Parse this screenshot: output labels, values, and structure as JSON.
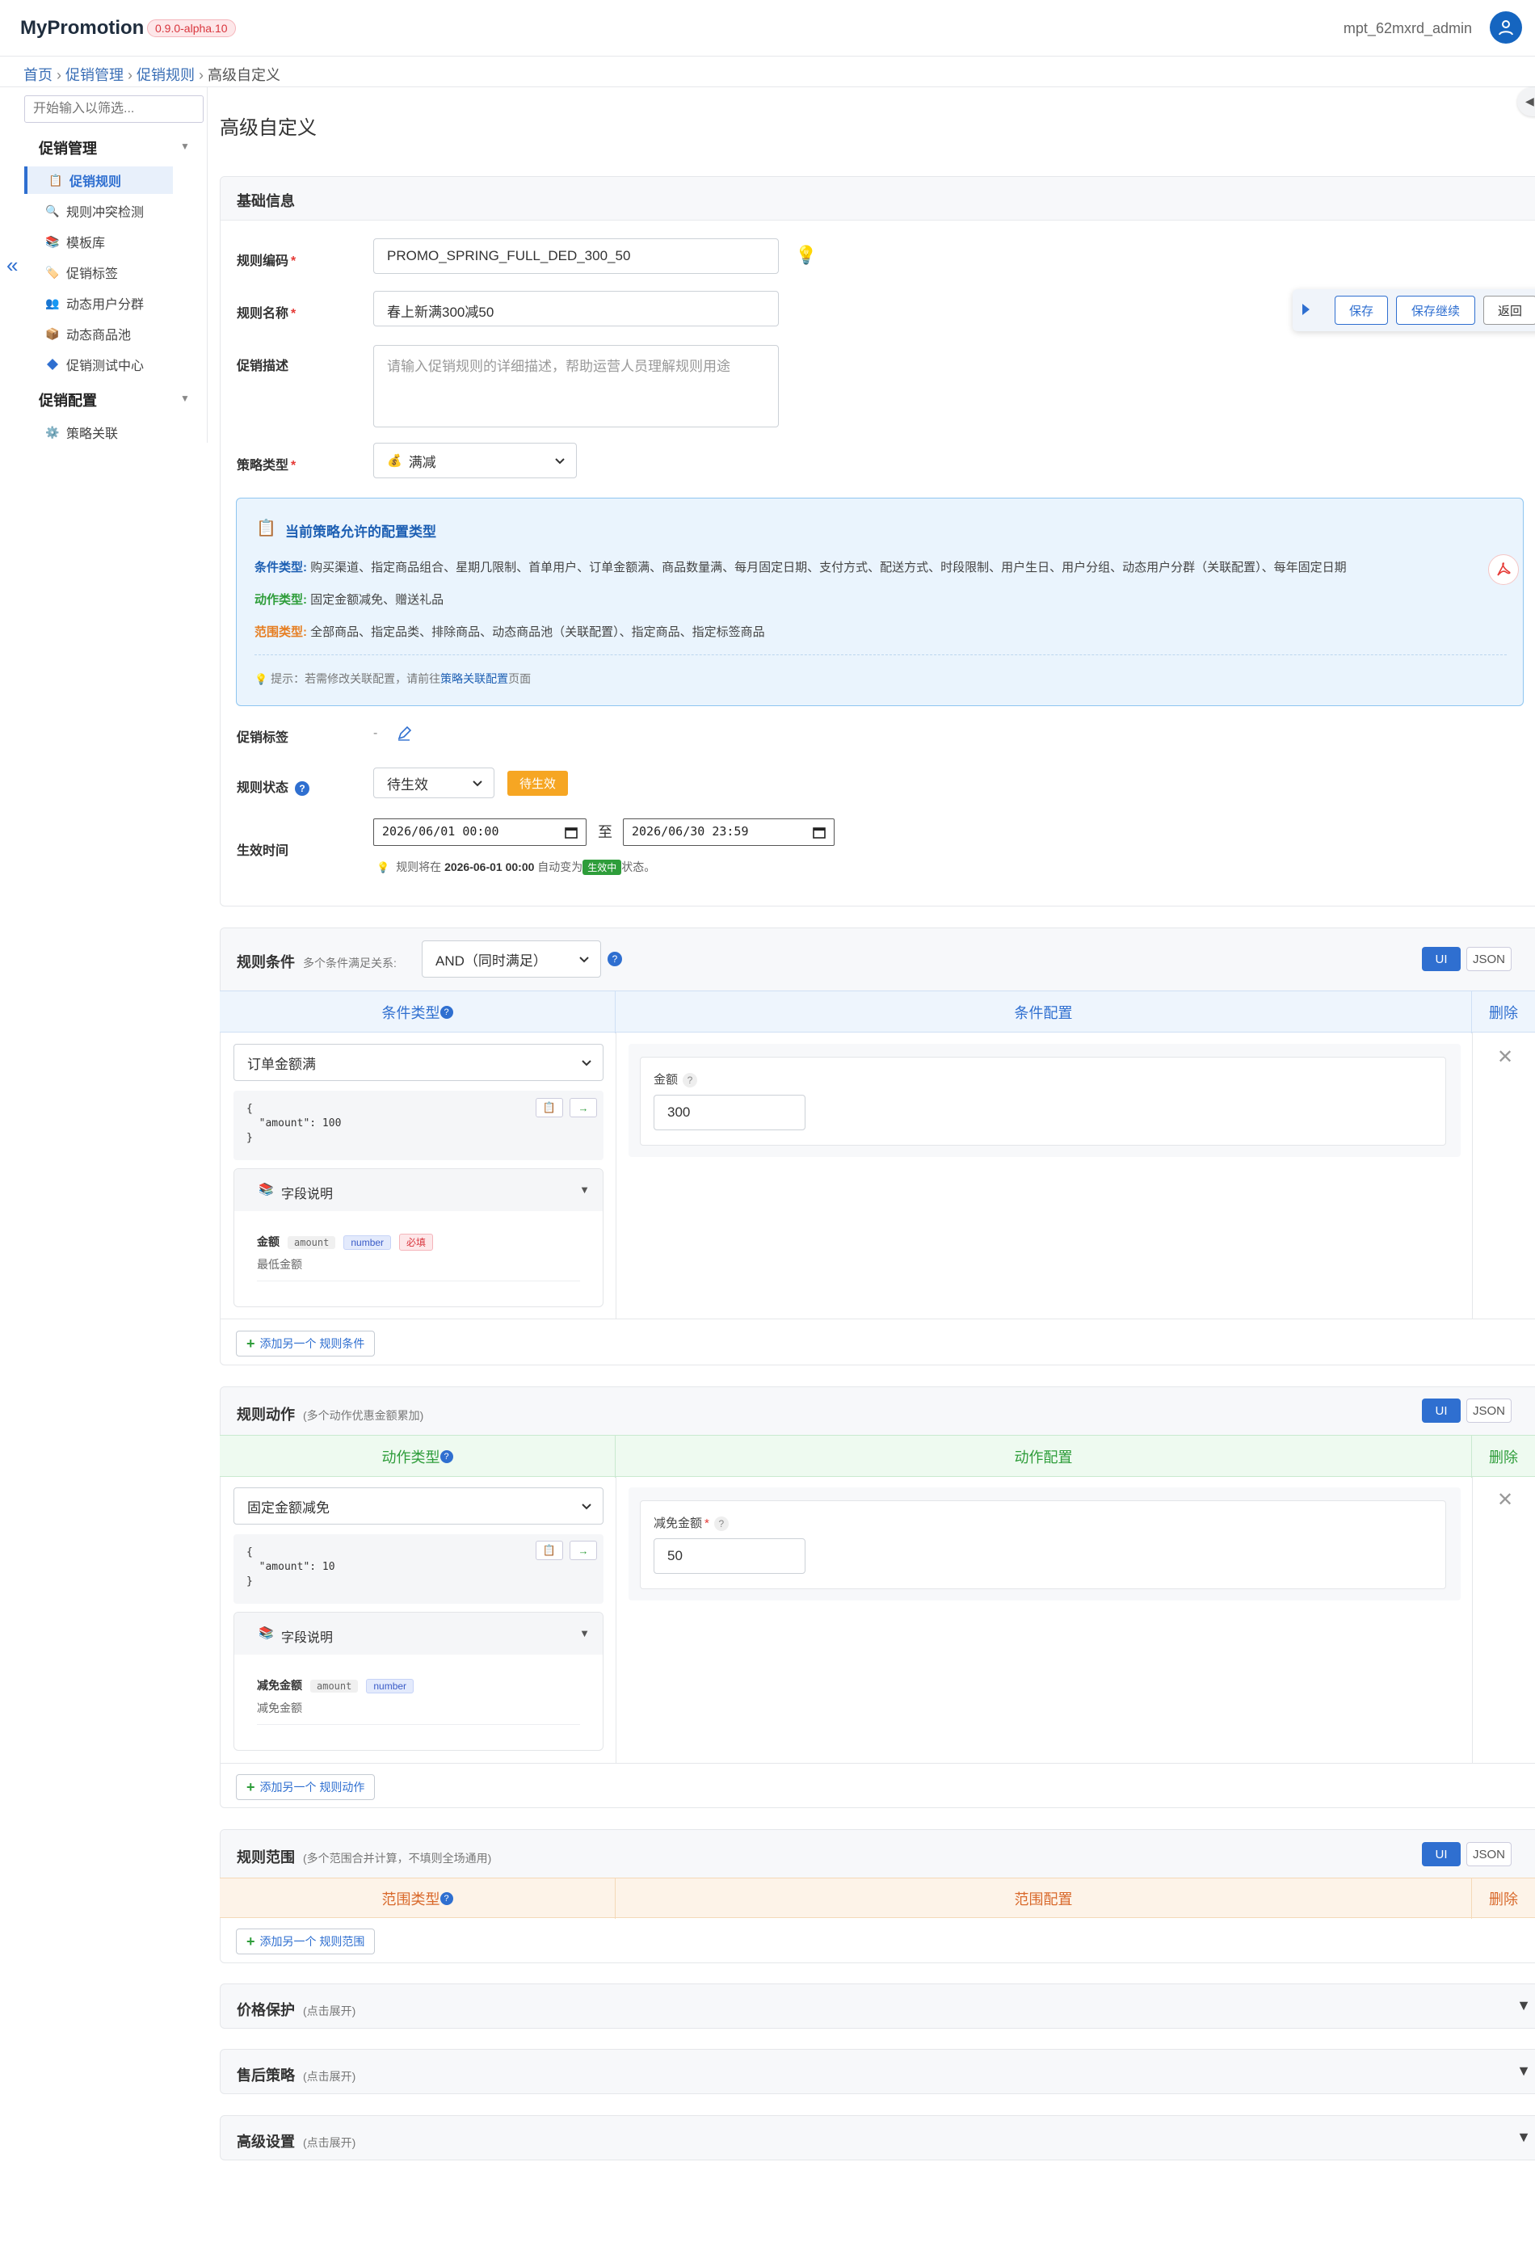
{
  "app": {
    "title": "MyPromotion",
    "version": "0.9.0-alpha.10",
    "user": "mpt_62mxrd_admin"
  },
  "breadcrumb": {
    "items": [
      "首页",
      "促销管理",
      "促销规则",
      "高级自定义"
    ]
  },
  "sidebar": {
    "filter_placeholder": "开始输入以筛选...",
    "groups": [
      {
        "label": "促销管理",
        "items": [
          {
            "label": "促销规则",
            "icon": "clipboard-icon",
            "active": true
          },
          {
            "label": "规则冲突检测",
            "icon": "magnifier-icon"
          },
          {
            "label": "模板库",
            "icon": "books-icon"
          },
          {
            "label": "促销标签",
            "icon": "tag-icon"
          },
          {
            "label": "动态用户分群",
            "icon": "users-icon"
          },
          {
            "label": "动态商品池",
            "icon": "package-icon"
          },
          {
            "label": "促销测试中心",
            "icon": "diamond-icon"
          }
        ]
      },
      {
        "label": "促销配置",
        "items": [
          {
            "label": "策略关联",
            "icon": "gear-icon"
          }
        ]
      }
    ]
  },
  "page": {
    "title": "高级自定义"
  },
  "basic": {
    "header": "基础信息",
    "code_label": "规则编码",
    "code_value": "PROMO_SPRING_FULL_DED_300_50",
    "name_label": "规则名称",
    "name_value": "春上新满300减50",
    "desc_label": "促销描述",
    "desc_placeholder": "请输入促销规则的详细描述，帮助运营人员理解规则用途",
    "strategy_label": "策略类型",
    "strategy_value": "满减",
    "tag_label": "促销标签",
    "tag_value": "-",
    "status_label": "规则状态",
    "status_select": "待生效",
    "status_badge": "待生效",
    "time_label": "生效时间",
    "time_start": "2026/06/01 00:00",
    "time_sep": "至",
    "time_end": "2026/06/30 23:59",
    "time_hint_prefix": "规则将在",
    "time_hint_date": "2026-06-01 00:00",
    "time_hint_mid": "自动变为",
    "time_hint_badge": "生效中",
    "time_hint_suffix": "状态。"
  },
  "allowed": {
    "title": "当前策略允许的配置类型",
    "condition_label": "条件类型:",
    "condition_text": "购买渠道、指定商品组合、星期几限制、首单用户、订单金额满、商品数量满、每月固定日期、支付方式、配送方式、时段限制、用户生日、用户分组、动态用户分群（关联配置）、每年固定日期",
    "action_label": "动作类型:",
    "action_text": "固定金额减免、赠送礼品",
    "scope_label": "范围类型:",
    "scope_text": "全部商品、指定品类、排除商品、动态商品池（关联配置）、指定商品、指定标签商品",
    "hint_prefix": "提示：若需修改关联配置，请前往",
    "hint_link": "策略关联配置",
    "hint_suffix": "页面"
  },
  "toolbar": {
    "save": "保存",
    "save_continue": "保存继续",
    "back": "返回"
  },
  "conditions": {
    "header": "规则条件",
    "relation_label": "多个条件满足关系:",
    "relation_value": "AND（同时满足）",
    "ui": "UI",
    "json": "JSON",
    "col_type": "条件类型",
    "col_config": "条件配置",
    "col_delete": "删除",
    "type_value": "订单金额满",
    "json_lines": [
      "{",
      "  \"amount\": 100",
      "}"
    ],
    "fields_title": "字段说明",
    "field_name": "金额",
    "field_key": "amount",
    "field_type": "number",
    "field_required": "必填",
    "field_desc": "最低金额",
    "config_label": "金额",
    "config_value": "300",
    "add": "添加另一个 规则条件"
  },
  "actions": {
    "header": "规则动作",
    "sub": "(多个动作优惠金额累加)",
    "ui": "UI",
    "json": "JSON",
    "col_type": "动作类型",
    "col_config": "动作配置",
    "col_delete": "删除",
    "type_value": "固定金额减免",
    "json_lines": [
      "{",
      "  \"amount\": 10",
      "}"
    ],
    "fields_title": "字段说明",
    "field_name": "减免金额",
    "field_key": "amount",
    "field_type": "number",
    "field_desc": "减免金额",
    "config_label": "减免金额",
    "config_value": "50",
    "add": "添加另一个 规则动作"
  },
  "scopes": {
    "header": "规则范围",
    "sub": "(多个范围合并计算，不填则全场通用)",
    "ui": "UI",
    "json": "JSON",
    "col_type": "范围类型",
    "col_config": "范围配置",
    "col_delete": "删除",
    "add": "添加另一个 规则范围"
  },
  "collapsed": [
    {
      "title": "价格保护",
      "hint": "(点击展开)"
    },
    {
      "title": "售后策略",
      "hint": "(点击展开)"
    },
    {
      "title": "高级设置",
      "hint": "(点击展开)"
    }
  ],
  "colors": {
    "primary": "#2f6fd0",
    "warning": "#f6a623",
    "success": "#2e9d3a",
    "danger": "#e53935"
  }
}
